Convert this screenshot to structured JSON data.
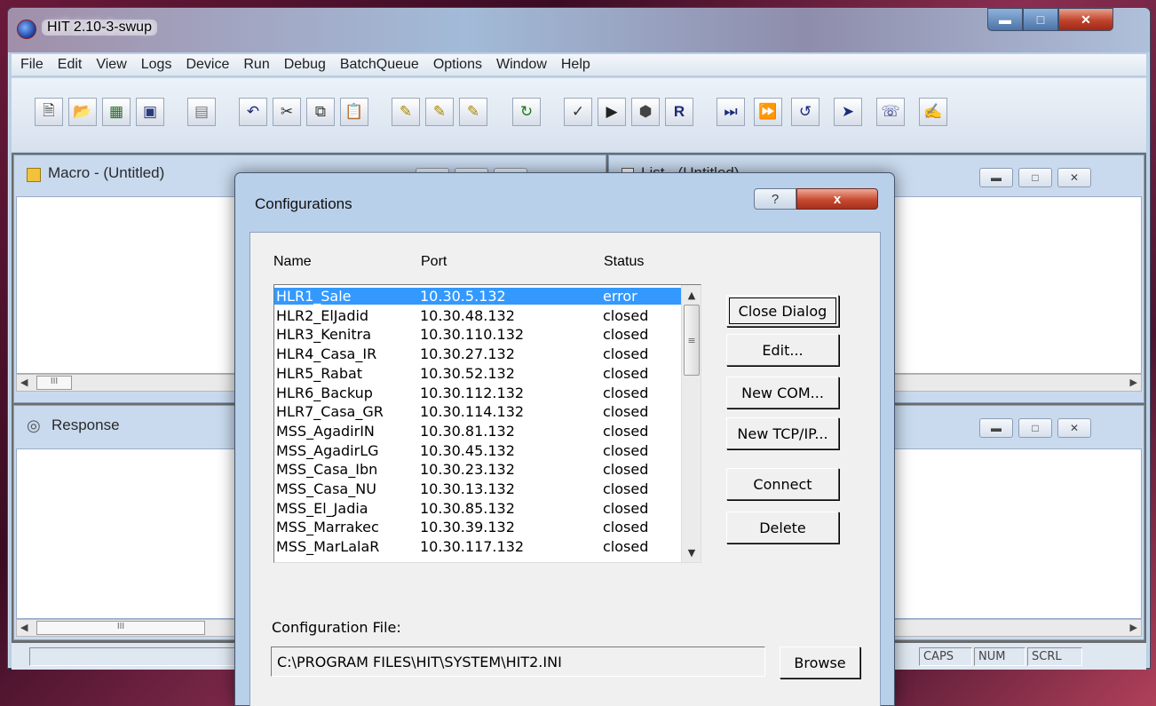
{
  "app": {
    "title": "HIT 2.10-3-swup"
  },
  "menu": [
    "File",
    "Edit",
    "View",
    "Logs",
    "Device",
    "Run",
    "Debug",
    "BatchQueue",
    "Options",
    "Window",
    "Help"
  ],
  "toolbar_icons": [
    "new-file-icon",
    "open-folder-icon",
    "open-device-icon",
    "save-icon",
    "log-icon",
    "undo-icon",
    "cut-icon",
    "copy-icon",
    "paste-icon",
    "tool-a-icon",
    "tool-b-icon",
    "tool-c-icon",
    "refresh-icon",
    "spellcheck-icon",
    "play-icon",
    "stop-icon",
    "record-icon",
    "step-icon",
    "step-multi-icon",
    "step-back-icon",
    "goto-icon",
    "device-icon",
    "help-icon"
  ],
  "macro_window": {
    "title": "Macro - (Untitled)",
    "scroll_grip": "III"
  },
  "list_window": {
    "title": "List - (Untitled)"
  },
  "response_window": {
    "title": "Response",
    "scroll_grip": "III"
  },
  "status": {
    "caps": "CAPS",
    "num": "NUM",
    "scrl": "SCRL"
  },
  "dialog": {
    "title": "Configurations",
    "help_glyph": "?",
    "close_glyph": "x",
    "columns": {
      "name": "Name",
      "port": "Port",
      "status": "Status"
    },
    "rows": [
      {
        "name": "HLR1_Sale",
        "port": "10.30.5.132",
        "status": "error"
      },
      {
        "name": "HLR2_ElJadid",
        "port": "10.30.48.132",
        "status": "closed"
      },
      {
        "name": "HLR3_Kenitra",
        "port": "10.30.110.132",
        "status": "closed"
      },
      {
        "name": "HLR4_Casa_IR",
        "port": "10.30.27.132",
        "status": "closed"
      },
      {
        "name": "HLR5_Rabat",
        "port": "10.30.52.132",
        "status": "closed"
      },
      {
        "name": "HLR6_Backup",
        "port": "10.30.112.132",
        "status": "closed"
      },
      {
        "name": "HLR7_Casa_GR",
        "port": "10.30.114.132",
        "status": "closed"
      },
      {
        "name": "MSS_AgadirIN",
        "port": "10.30.81.132",
        "status": "closed"
      },
      {
        "name": "MSS_AgadirLG",
        "port": "10.30.45.132",
        "status": "closed"
      },
      {
        "name": "MSS_Casa_Ibn",
        "port": "10.30.23.132",
        "status": "closed"
      },
      {
        "name": "MSS_Casa_NU",
        "port": "10.30.13.132",
        "status": "closed"
      },
      {
        "name": "MSS_El_Jadia",
        "port": "10.30.85.132",
        "status": "closed"
      },
      {
        "name": "MSS_Marrakec",
        "port": "10.30.39.132",
        "status": "closed"
      },
      {
        "name": "MSS_MarLalaR",
        "port": "10.30.117.132",
        "status": "closed"
      }
    ],
    "buttons": {
      "close_dialog": "Close Dialog",
      "edit": "Edit...",
      "new_com": "New COM...",
      "new_tcpip": "New TCP/IP...",
      "connect": "Connect",
      "delete": "Delete",
      "browse": "Browse"
    },
    "config_file_label": "Configuration File:",
    "config_file_value": "C:\\PROGRAM FILES\\HIT\\SYSTEM\\HIT2.INI"
  }
}
